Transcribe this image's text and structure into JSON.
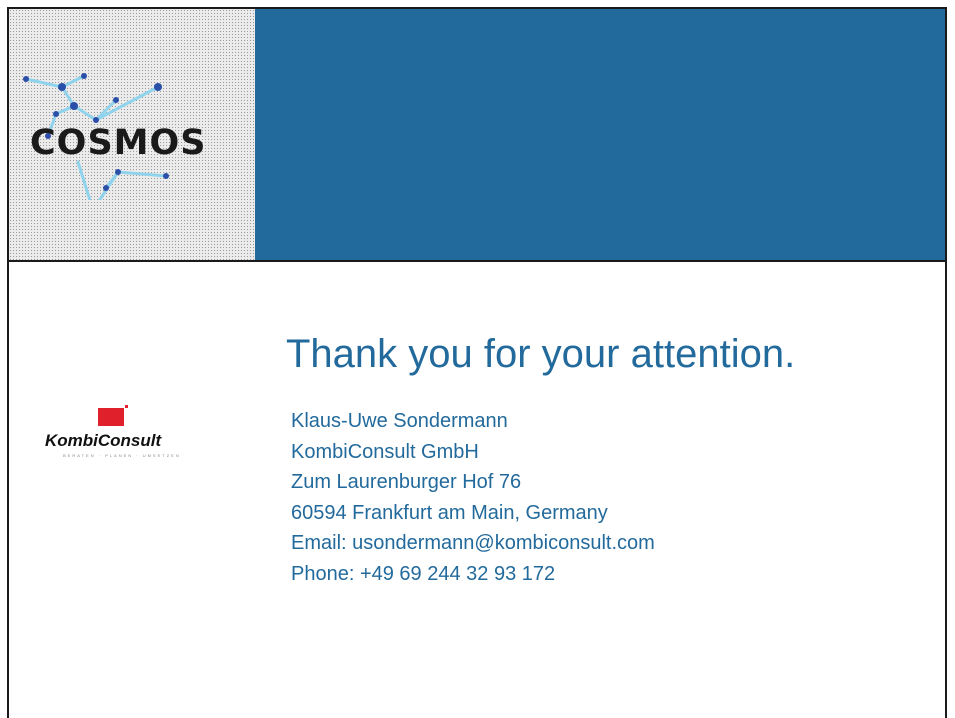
{
  "slide": {
    "logo": {
      "text": "COSMOS"
    },
    "title": "Thank you for your attention.",
    "contact": [
      "Klaus-Uwe Sondermann",
      "KombiConsult GmbH",
      "Zum Laurenburger Hof 76",
      "60594 Frankfurt am Main, Germany",
      "Email: usondermann@kombiconsult.com",
      "Phone: +49 69 244 32 93 172"
    ],
    "partner_logo": {
      "name": "KombiConsult",
      "tagline": "BERATEN · PLANEN · UMSETZEN"
    }
  },
  "colors": {
    "header_band": "#236a9c",
    "title_text": "#236a9c",
    "logo_red": "#e0202a",
    "network_light": "#8fd3ec",
    "network_dark": "#2a4fa8"
  }
}
